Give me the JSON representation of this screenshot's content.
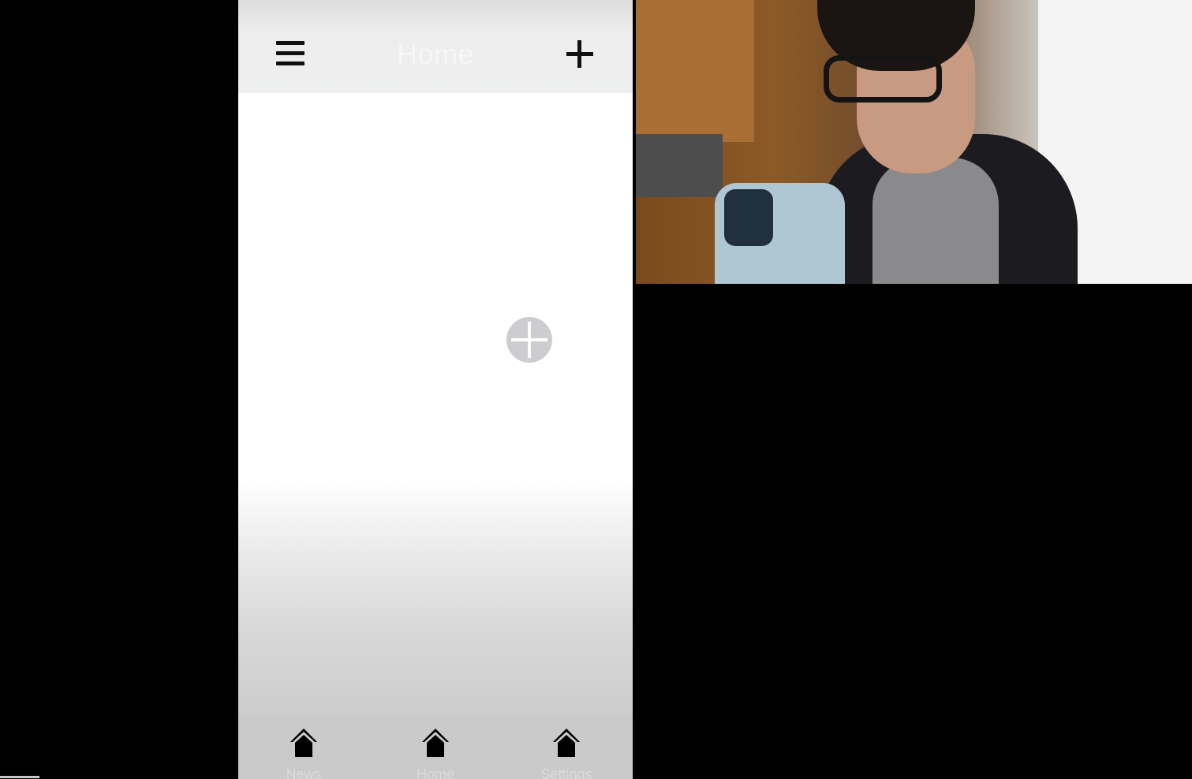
{
  "app": {
    "header": {
      "title": "Home",
      "menu_icon": "hamburger-menu-icon",
      "add_icon": "plus-icon"
    },
    "content": {
      "fab_icon": "plus-circle-icon"
    },
    "tabbar": {
      "tabs": [
        {
          "label": "News",
          "icon": "house-icon"
        },
        {
          "label": "Home",
          "icon": "house-icon"
        },
        {
          "label": "Settings",
          "icon": "house-icon"
        }
      ]
    }
  },
  "colors": {
    "accent_red": "#b8131b",
    "header_bg": "#eeefef",
    "fab_bg": "#cdcdd0",
    "tabbar_bg": "#cacaca"
  }
}
